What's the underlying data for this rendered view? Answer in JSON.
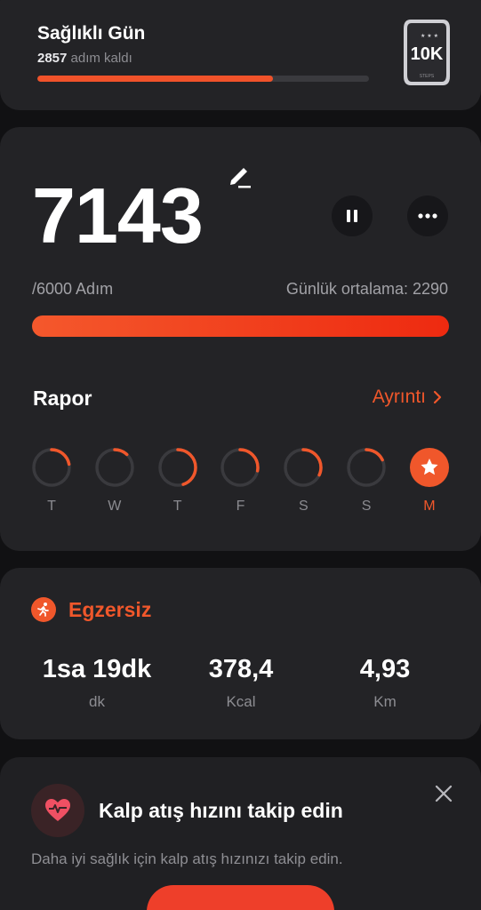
{
  "goal": {
    "title": "Sağlıklı Gün",
    "remaining_value": "2857",
    "remaining_label": "adım kaldı",
    "progress": 0.71,
    "badge_text": "10K",
    "badge_sub": "STEPS"
  },
  "steps": {
    "count": "7143",
    "goal_label": "/6000 Adım",
    "daily_average": "Günlük ortalama: 2290",
    "progress": 1.0
  },
  "report": {
    "title": "Rapor",
    "details_label": "Ayrıntı",
    "days": [
      {
        "label": "T",
        "progress": 0.22,
        "active": false
      },
      {
        "label": "W",
        "progress": 0.12,
        "active": false
      },
      {
        "label": "T",
        "progress": 0.45,
        "active": false
      },
      {
        "label": "F",
        "progress": 0.28,
        "active": false
      },
      {
        "label": "S",
        "progress": 0.32,
        "active": false
      },
      {
        "label": "S",
        "progress": 0.18,
        "active": false
      },
      {
        "label": "M",
        "progress": 1.0,
        "active": true
      }
    ]
  },
  "exercise": {
    "title": "Egzersiz",
    "stats": [
      {
        "value": "1sa 19dk",
        "unit": "dk"
      },
      {
        "value": "378,4",
        "unit": "Kcal"
      },
      {
        "value": "4,93",
        "unit": "Km"
      }
    ]
  },
  "heart": {
    "title": "Kalp atış hızını takip edin",
    "description": "Daha iyi sağlık için kalp atış hızınızı takip edin."
  },
  "colors": {
    "accent": "#f0572b",
    "card": "#232326",
    "background": "#111113"
  }
}
